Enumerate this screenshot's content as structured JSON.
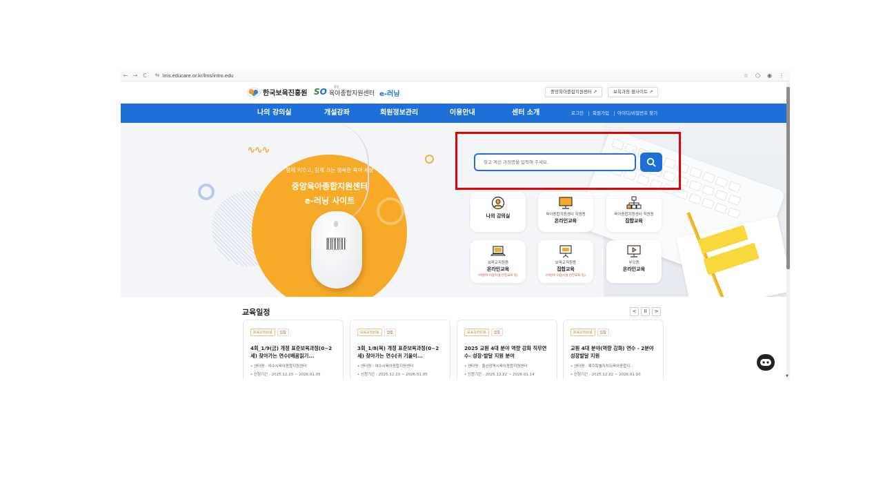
{
  "browser": {
    "url": "lms.educare.or.kr/lms/intro.edu",
    "back": "←",
    "forward": "→",
    "reload": "C",
    "info_icon": "⇆",
    "star": "☆",
    "ext": "⬡",
    "profile": "◉",
    "menu": "⋮"
  },
  "header": {
    "kcpi_logo": "한국보육진흥원",
    "center_small": "중앙",
    "center_name": "육아종합지원센터",
    "elearning": "e-러닝",
    "ext_links": [
      "중앙육아종합지원센터 ↗",
      "보육과정 웹사이트 ↗"
    ]
  },
  "gnb": {
    "menus": [
      "나의 강의실",
      "개설강좌",
      "회원정보관리",
      "이용안내",
      "센터 소개"
    ],
    "util": [
      "로그인",
      "회원가입",
      "아이디/비밀번호 찾기"
    ]
  },
  "hero": {
    "sub": "함께 키우고, 함께 크는 행복한 육아 세상",
    "title1": "중앙육아종합지원센터",
    "title2": "e-러닝 사이트"
  },
  "search": {
    "placeholder": "찾고 계신 과정명을 입력해 주세요."
  },
  "quick_menu": [
    {
      "l1": "",
      "l2": "나의 강의실",
      "l3": ""
    },
    {
      "l1": "육아종합지원센터 직원용",
      "l2": "온라인교육",
      "l3": ""
    },
    {
      "l1": "육아종합지원센터 직원용",
      "l2": "집합교육",
      "l3": ""
    },
    {
      "l1": "보육교직원용",
      "l2": "온라인교육",
      "l3": "(어린이 이용시설 안전교육 등)"
    },
    {
      "l1": "보육교직원용",
      "l2": "집합교육",
      "l3": "(어린이 이용시설 안전교육 등)"
    },
    {
      "l1": "부모용",
      "l2": "온라인교육",
      "l3": ""
    }
  ],
  "schedule": {
    "title": "교육일정",
    "prev": "<",
    "pause": "II",
    "next": ">",
    "cards": [
      {
        "tag1": "보육교직원용",
        "tag2": "집합",
        "title": "4회_1/9(금) 개정 표준보육과정(0~2세) 찾아가는 연수[배움읽기...",
        "center": "• 센터명 : 여수시육아종합지원센터",
        "period": "• 신청기간 : 2025.12.23 ~ 2026.01.05"
      },
      {
        "tag1": "보육교직원용",
        "tag2": "집합",
        "title": "3회_1/8(목) 개정 표준보육과정(0~2세) 찾아가는 연수[귀 기울이...",
        "center": "• 센터명 : 여수시육아종합지원센터",
        "period": "• 신청기간 : 2025.12.23 ~ 2026.01.05"
      },
      {
        "tag1": "보육교직원용",
        "tag2": "집합",
        "title": "2025 교원 4대 분야 역량 강화 직무연수- 성장·발달 지원 분야",
        "center": "• 센터명 : 울산광역시육아종합지원센터",
        "period": "• 신청기간 : 2025.12.22 ~ 2026.01.14"
      },
      {
        "tag1": "보육교직원용",
        "tag2": "집합",
        "title": "교원 4대 분야(역량 강화) 연수 - 2분야 성장발달 지원",
        "center": "• 센터명 : 제주특별자치도육아종합지...",
        "period": "• 신청기간 : 2025.12.22 ~ 2026.01.10"
      }
    ]
  },
  "colors": {
    "primary": "#1e6fd8",
    "accent": "#f7a928",
    "highlight": "#e60000"
  }
}
